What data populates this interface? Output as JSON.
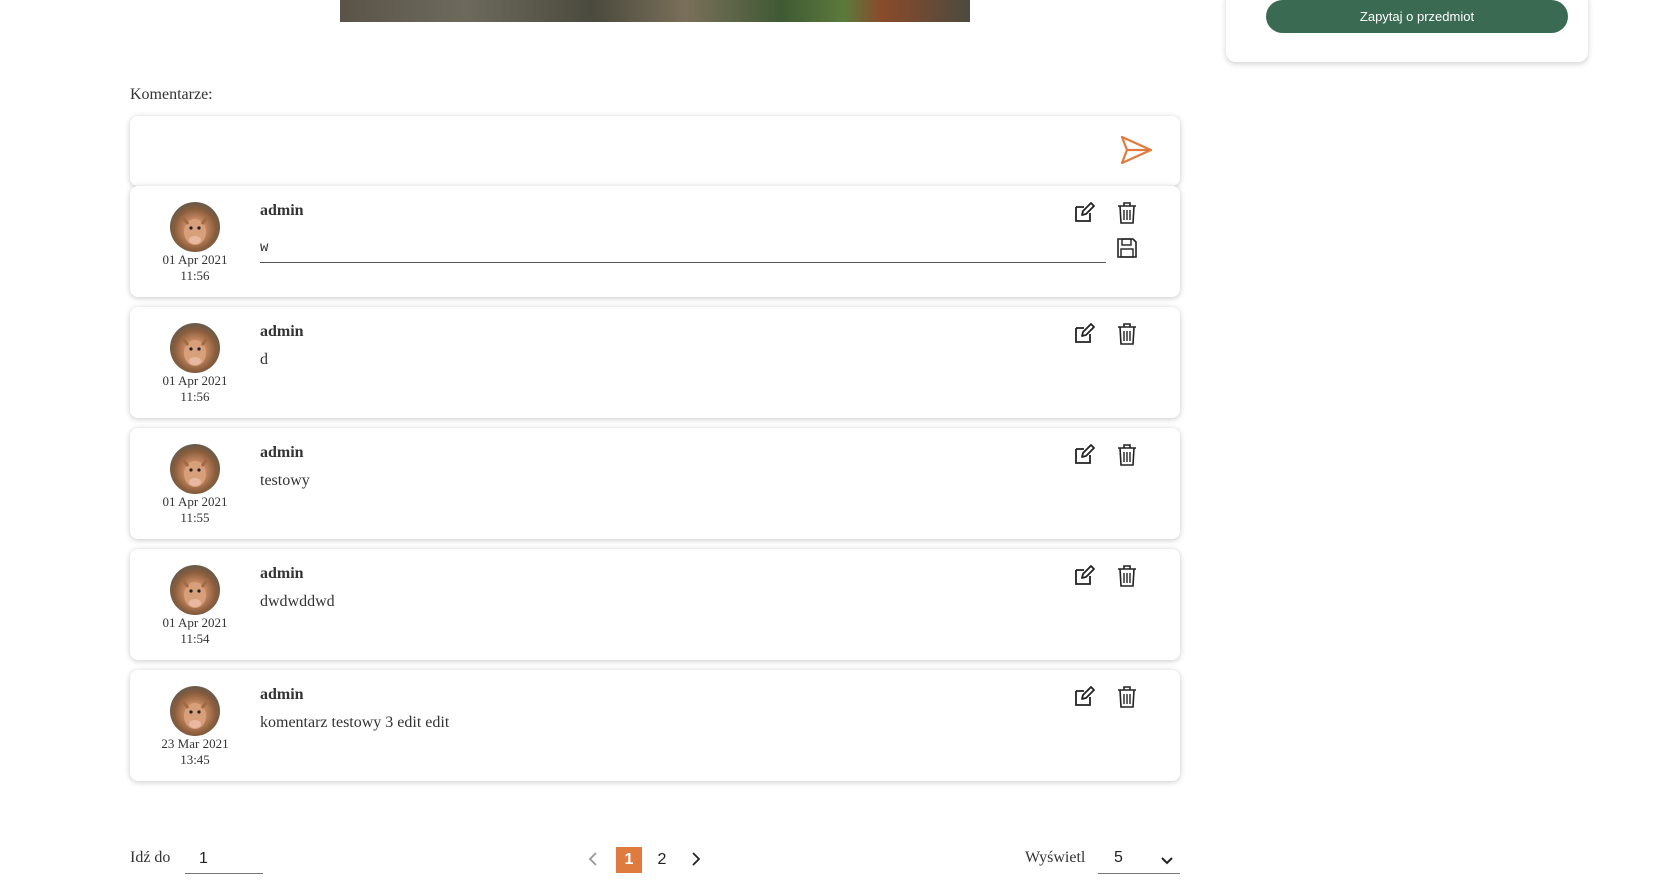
{
  "sidebar": {
    "ask_button": "Zapytaj o przedmiot"
  },
  "comments": {
    "label": "Komentarze:",
    "input_placeholder": "",
    "items": [
      {
        "author": "admin",
        "date": "01 Apr 2021",
        "time": "11:56",
        "text": "w",
        "editing": true
      },
      {
        "author": "admin",
        "date": "01 Apr 2021",
        "time": "11:56",
        "text": "d"
      },
      {
        "author": "admin",
        "date": "01 Apr 2021",
        "time": "11:55",
        "text": "testowy"
      },
      {
        "author": "admin",
        "date": "01 Apr 2021",
        "time": "11:54",
        "text": "dwdwddwd"
      },
      {
        "author": "admin",
        "date": "23 Mar 2021",
        "time": "13:45",
        "text": "komentarz testowy 3 edit edit"
      }
    ]
  },
  "pagination": {
    "goto_label": "Idź do",
    "goto_value": "1",
    "current_page": "1",
    "pages": [
      "1",
      "2"
    ],
    "show_label": "Wyświetl",
    "page_size": "5"
  },
  "colors": {
    "accent": "#e07b3f",
    "primary_button": "#3a6b52"
  },
  "icons": [
    "send-icon",
    "edit-icon",
    "trash-icon",
    "save-icon",
    "chevron-left-icon",
    "chevron-right-icon",
    "chevron-down-icon"
  ]
}
